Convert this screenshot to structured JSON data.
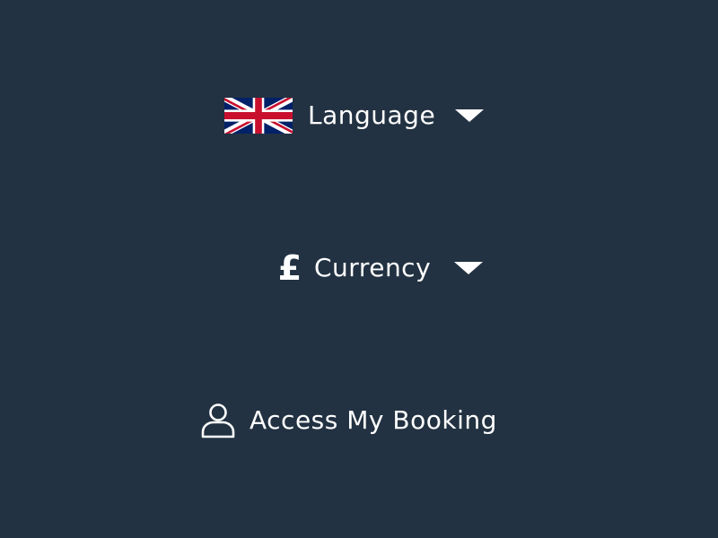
{
  "language": {
    "label": "Language",
    "icon": "uk-flag-icon",
    "dropdown_icon": "caret-down-icon"
  },
  "currency": {
    "symbol": "£",
    "label": "Currency",
    "dropdown_icon": "caret-down-icon"
  },
  "booking": {
    "label": "Access My Booking",
    "icon": "user-icon"
  },
  "colors": {
    "background": "#223242",
    "text": "#ffffff",
    "flag_blue": "#012169",
    "flag_red": "#C8102E"
  }
}
